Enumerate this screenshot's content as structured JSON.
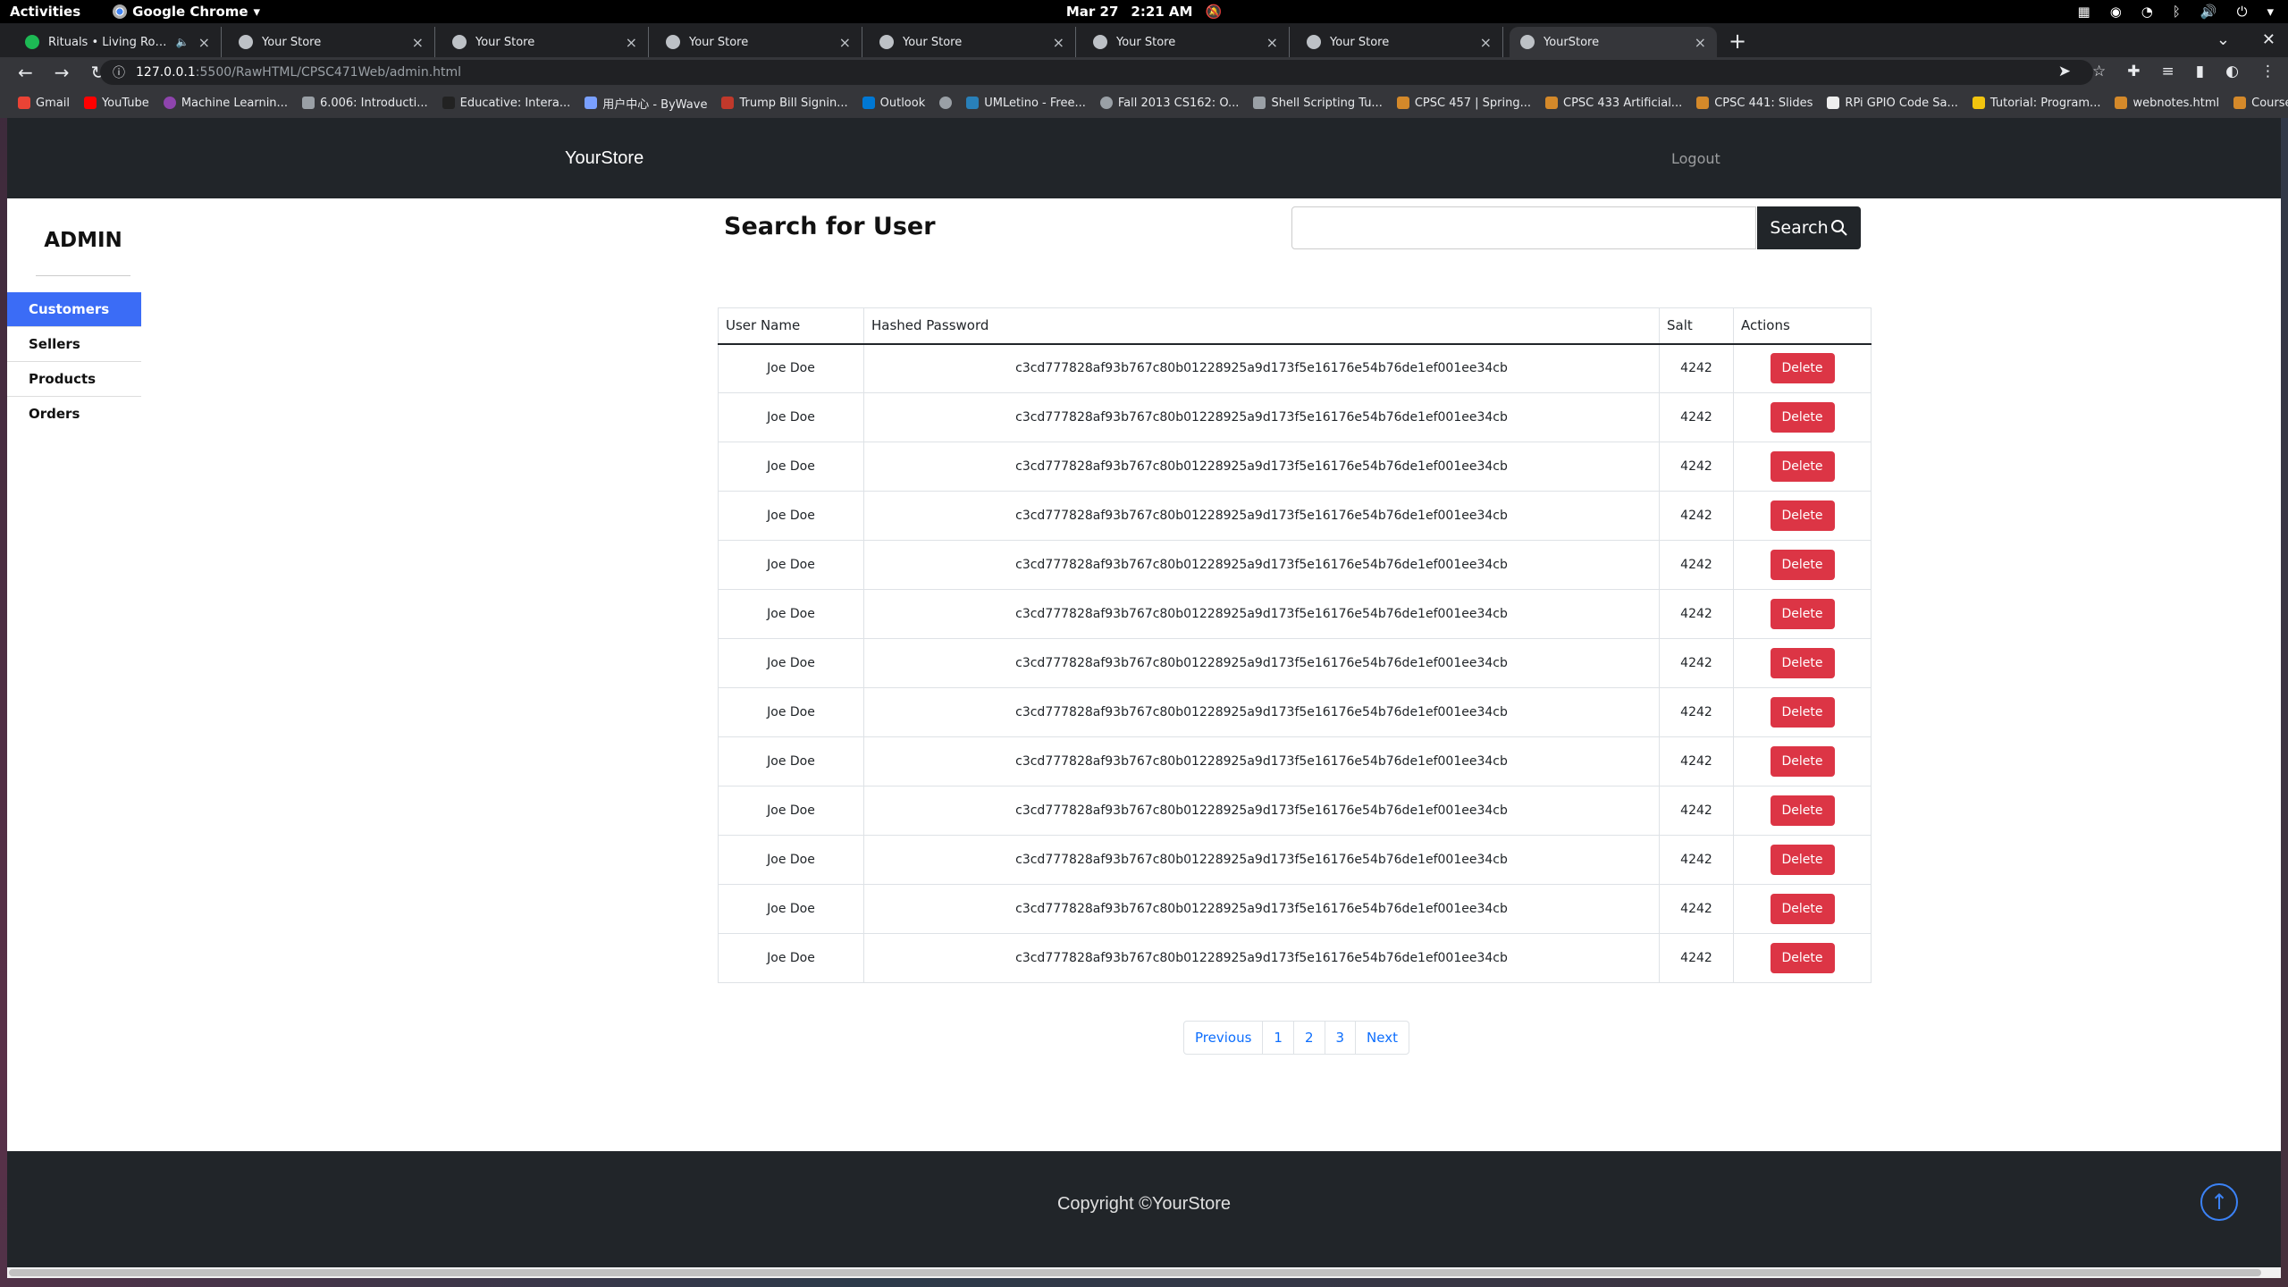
{
  "gnome": {
    "activities": "Activities",
    "app": "Google Chrome",
    "clock_date": "Mar 27",
    "clock_time": "2:21 AM"
  },
  "tabs": [
    {
      "title": "Rituals • Living Room, M",
      "icon": "spotify-icon"
    },
    {
      "title": "Your Store"
    },
    {
      "title": "Your Store"
    },
    {
      "title": "Your Store"
    },
    {
      "title": "Your Store"
    },
    {
      "title": "Your Store"
    },
    {
      "title": "Your Store"
    },
    {
      "title": "YourStore"
    }
  ],
  "address": {
    "host": "127.0.0.1",
    "path": ":5500/RawHTML/CPSC471Web/admin.html"
  },
  "bookmarks": [
    "Gmail",
    "YouTube",
    "Machine Learnin...",
    "6.006: Introducti...",
    "Educative: Intera...",
    "用户中心 - ByWave",
    "Trump Bill Signin...",
    "Outlook",
    "",
    "UMLetino - Free...",
    "Fall 2013 CS162: O...",
    "Shell Scripting Tu...",
    "CPSC 457 | Spring...",
    "CPSC 433 Artificial...",
    "CPSC 441: Slides",
    "RPi GPIO Code Sa...",
    "Tutorial: Program...",
    "webnotes.html",
    "Course Schedule,..."
  ],
  "site": {
    "brand": "YourStore",
    "logout": "Logout",
    "sidebar_title": "ADMIN",
    "sidebar_items": [
      "Customers",
      "Sellers",
      "Products",
      "Orders"
    ],
    "search_title": "Search for User",
    "search_button": "Search",
    "columns": [
      "User Name",
      "Hashed Password",
      "Salt",
      "Actions"
    ],
    "rows": [
      {
        "name": "Joe Doe",
        "hash": "c3cd777828af93b767c80b01228925a9d173f5e16176e54b76de1ef001ee34cb",
        "salt": "4242"
      },
      {
        "name": "Joe Doe",
        "hash": "c3cd777828af93b767c80b01228925a9d173f5e16176e54b76de1ef001ee34cb",
        "salt": "4242"
      },
      {
        "name": "Joe Doe",
        "hash": "c3cd777828af93b767c80b01228925a9d173f5e16176e54b76de1ef001ee34cb",
        "salt": "4242"
      },
      {
        "name": "Joe Doe",
        "hash": "c3cd777828af93b767c80b01228925a9d173f5e16176e54b76de1ef001ee34cb",
        "salt": "4242"
      },
      {
        "name": "Joe Doe",
        "hash": "c3cd777828af93b767c80b01228925a9d173f5e16176e54b76de1ef001ee34cb",
        "salt": "4242"
      },
      {
        "name": "Joe Doe",
        "hash": "c3cd777828af93b767c80b01228925a9d173f5e16176e54b76de1ef001ee34cb",
        "salt": "4242"
      },
      {
        "name": "Joe Doe",
        "hash": "c3cd777828af93b767c80b01228925a9d173f5e16176e54b76de1ef001ee34cb",
        "salt": "4242"
      },
      {
        "name": "Joe Doe",
        "hash": "c3cd777828af93b767c80b01228925a9d173f5e16176e54b76de1ef001ee34cb",
        "salt": "4242"
      },
      {
        "name": "Joe Doe",
        "hash": "c3cd777828af93b767c80b01228925a9d173f5e16176e54b76de1ef001ee34cb",
        "salt": "4242"
      },
      {
        "name": "Joe Doe",
        "hash": "c3cd777828af93b767c80b01228925a9d173f5e16176e54b76de1ef001ee34cb",
        "salt": "4242"
      },
      {
        "name": "Joe Doe",
        "hash": "c3cd777828af93b767c80b01228925a9d173f5e16176e54b76de1ef001ee34cb",
        "salt": "4242"
      },
      {
        "name": "Joe Doe",
        "hash": "c3cd777828af93b767c80b01228925a9d173f5e16176e54b76de1ef001ee34cb",
        "salt": "4242"
      },
      {
        "name": "Joe Doe",
        "hash": "c3cd777828af93b767c80b01228925a9d173f5e16176e54b76de1ef001ee34cb",
        "salt": "4242"
      }
    ],
    "delete_label": "Delete",
    "pagination": [
      "Previous",
      "1",
      "2",
      "3",
      "Next"
    ],
    "copyright": "Copyright ©YourStore"
  },
  "colors": {
    "nav_bg": "#212529",
    "sidebar_active": "#3b6cf6",
    "delete": "#dc3545",
    "link": "#0d6efd"
  }
}
